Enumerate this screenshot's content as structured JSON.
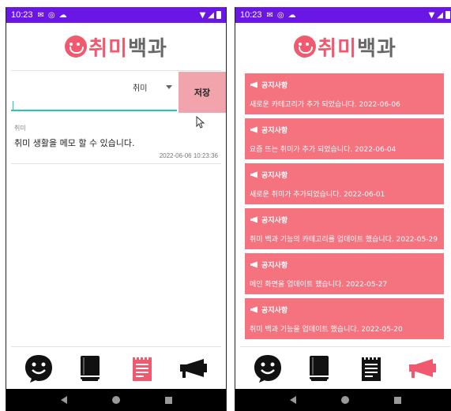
{
  "status": {
    "time": "10:23"
  },
  "app": {
    "logo_text_a": "취미",
    "logo_text_b": "백과"
  },
  "memo_screen": {
    "category_selected": "취미",
    "input_value": "",
    "save_label": "저장",
    "memo": {
      "category": "취미",
      "text": "취미 생활을 메모 할 수 있습니다.",
      "date": "2022-06-06 10:23:36"
    }
  },
  "notice_screen": {
    "notices": [
      {
        "title": "공지사항",
        "body": "새로운 카테고리가 추가 되었습니다. 2022-06-06"
      },
      {
        "title": "공지사항",
        "body": "요즘 뜨는 취미가 추가 되었습니다. 2022-06-04"
      },
      {
        "title": "공지사항",
        "body": "새로운 취미가 추가되었습니다. 2022-06-01"
      },
      {
        "title": "공지사항",
        "body": "취미 백과 기능의 카테고리를 업데이트 했습니다. 2022-05-29"
      },
      {
        "title": "공지사항",
        "body": "메인 화면을 업데이트 했습니다. 2022-05-27"
      },
      {
        "title": "공지사항",
        "body": "취미 백과 기능을 업데이트 했습니다. 2022-05-20"
      }
    ]
  },
  "colors": {
    "status_bar": "#6a17e6",
    "accent_pink": "#f0596e",
    "notice_bg": "#f4737f",
    "save_button": "#f2a4ad",
    "input_underline": "#26c6b8"
  },
  "icons": {
    "nav": [
      "smile-chat-icon",
      "book-icon",
      "notepad-icon",
      "megaphone-icon"
    ]
  }
}
